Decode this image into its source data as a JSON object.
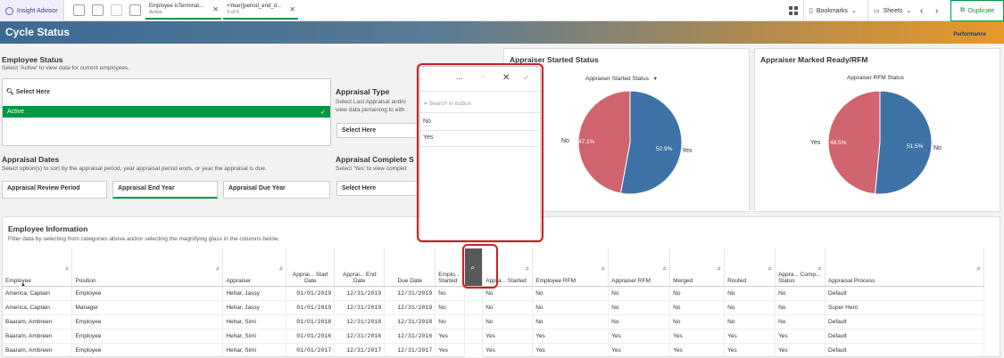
{
  "topbar": {
    "insight_label": "Insight Advisor",
    "chips": [
      {
        "title": "Employee IsTerminat...",
        "sub": "Active"
      },
      {
        "title": "=Year([period_end_d...",
        "sub": "3 of 9"
      }
    ],
    "bookmarks_label": "Bookmarks",
    "sheets_label": "Sheets",
    "duplicate_label": "Duplicate"
  },
  "header": {
    "title": "Cycle Status",
    "logo": "Performance"
  },
  "employee_status": {
    "title": "Employee Status",
    "subtitle": "Select 'Active' to view data for current employees.",
    "placeholder": "Select Here",
    "active_item": "Active"
  },
  "appraisal_type": {
    "title": "Appraisal Type",
    "subtitle_1": "Select Last Appraisal and/o",
    "subtitle_2": "view data pertaining to eith",
    "placeholder": "Select Here"
  },
  "appraisal_dates": {
    "title": "Appraisal Dates",
    "subtitle": "Select option(s) to sort by the appraisal period, year appraisal period ends, or year the appraisal is due.",
    "buttons": [
      "Appraisal Review Period",
      "Appraisal End Year",
      "Appraisal Due Year"
    ]
  },
  "appraisal_complete": {
    "title": "Appraisal Complete S",
    "subtitle": "Select 'Yes' to view complet",
    "placeholder": "Select Here"
  },
  "listbox_popup": {
    "more": "...",
    "search_placeholder": "Search in listbox",
    "items": [
      "No",
      "Yes"
    ]
  },
  "started_chart": {
    "title": "Appraiser Started Status",
    "dimension_label": "Appraiser Started Status",
    "chart_data": {
      "type": "pie",
      "slices": [
        {
          "label": "No",
          "value": 47.1,
          "color": "#d0646f"
        },
        {
          "label": "Yes",
          "value": 52.9,
          "color": "#3f73a8"
        }
      ]
    },
    "labels": {
      "no": "No",
      "yes": "Yes",
      "no_pct": "47.1%",
      "yes_pct": "52.9%"
    }
  },
  "rfm_chart": {
    "title": "Appraiser Marked Ready/RFM",
    "dimension_label": "Appraiser RFM Status",
    "chart_data": {
      "type": "pie",
      "slices": [
        {
          "label": "Yes",
          "value": 48.5,
          "color": "#d0646f"
        },
        {
          "label": "No",
          "value": 51.5,
          "color": "#3f73a8"
        }
      ]
    },
    "labels": {
      "yes": "Yes",
      "no": "No",
      "yes_pct": "48.5%",
      "no_pct": "51.5%"
    }
  },
  "employee_info": {
    "title": "Employee Information",
    "subtitle": "Filter data by selecting from categories above and/or selecting the magnifying glass in the columns below.",
    "columns": [
      "Employee",
      "Position",
      "Appraiser",
      "Apprai... Start Date",
      "Apprai... End Date",
      "Due Date",
      "Emplo... Started",
      "",
      "Appra... Started",
      "Employee RFM",
      "Appraiser RFM",
      "Merged",
      "Routed",
      "Appra... Comp... Status",
      "Appraisal Process"
    ],
    "rows": [
      [
        "America, Captain",
        "Employee",
        "Hehar, Jassy",
        "01/01/2019",
        "12/31/2019",
        "12/31/2019",
        "No",
        "",
        "No",
        "No",
        "No",
        "No",
        "No",
        "No",
        "Default"
      ],
      [
        "America, Captain",
        "Manager",
        "Hehar, Jassy",
        "01/01/2019",
        "12/31/2019",
        "12/31/2019",
        "No",
        "",
        "No",
        "No",
        "No",
        "No",
        "No",
        "No",
        "Super Hero"
      ],
      [
        "Baaram, Ambreen",
        "Employee",
        "Hehar, Simi",
        "01/01/2018",
        "12/31/2018",
        "12/31/2018",
        "No",
        "",
        "No",
        "No",
        "No",
        "No",
        "No",
        "No",
        "Default"
      ],
      [
        "Baaram, Ambreen",
        "Employee",
        "Hehar, Simi",
        "01/01/2016",
        "12/31/2016",
        "12/31/2016",
        "Yes",
        "",
        "Yes",
        "Yes",
        "Yes",
        "Yes",
        "Yes",
        "Yes",
        "Default"
      ],
      [
        "Baaram, Ambreen",
        "Employee",
        "Hehar, Simi",
        "01/01/2017",
        "12/31/2017",
        "12/31/2017",
        "Yes",
        "",
        "Yes",
        "Yes",
        "Yes",
        "Yes",
        "Yes",
        "Yes",
        "Default"
      ]
    ]
  }
}
